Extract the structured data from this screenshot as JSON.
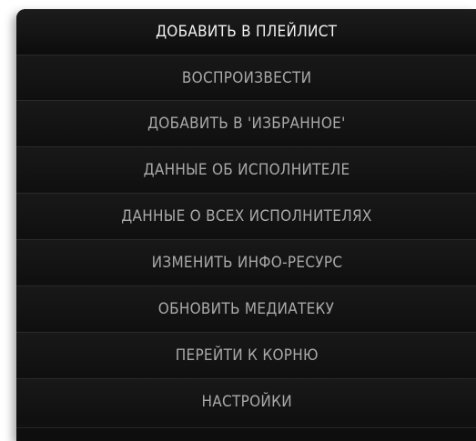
{
  "menu": {
    "items": [
      {
        "label": "ДОБАВИТЬ В ПЛЕЙЛИСТ",
        "selected": true
      },
      {
        "label": "ВОСПРОИЗВЕСТИ",
        "selected": false
      },
      {
        "label": "ДОБАВИТЬ В 'ИЗБРАННОЕ'",
        "selected": false
      },
      {
        "label": "ДАННЫЕ ОБ ИСПОЛНИТЕЛЕ",
        "selected": false
      },
      {
        "label": "ДАННЫЕ О ВСЕХ ИСПОЛНИТЕЛЯХ",
        "selected": false
      },
      {
        "label": "ИЗМЕНИТЬ ИНФО-РЕСУРС",
        "selected": false
      },
      {
        "label": "ОБНОВИТЬ МЕДИАТЕКУ",
        "selected": false
      },
      {
        "label": "ПЕРЕЙТИ К КОРНЮ",
        "selected": false
      },
      {
        "label": "НАСТРОЙКИ",
        "selected": false
      }
    ]
  },
  "colors": {
    "background": "#111111",
    "text": "#a9a9a9",
    "selected_text": "#f2f2f2"
  }
}
